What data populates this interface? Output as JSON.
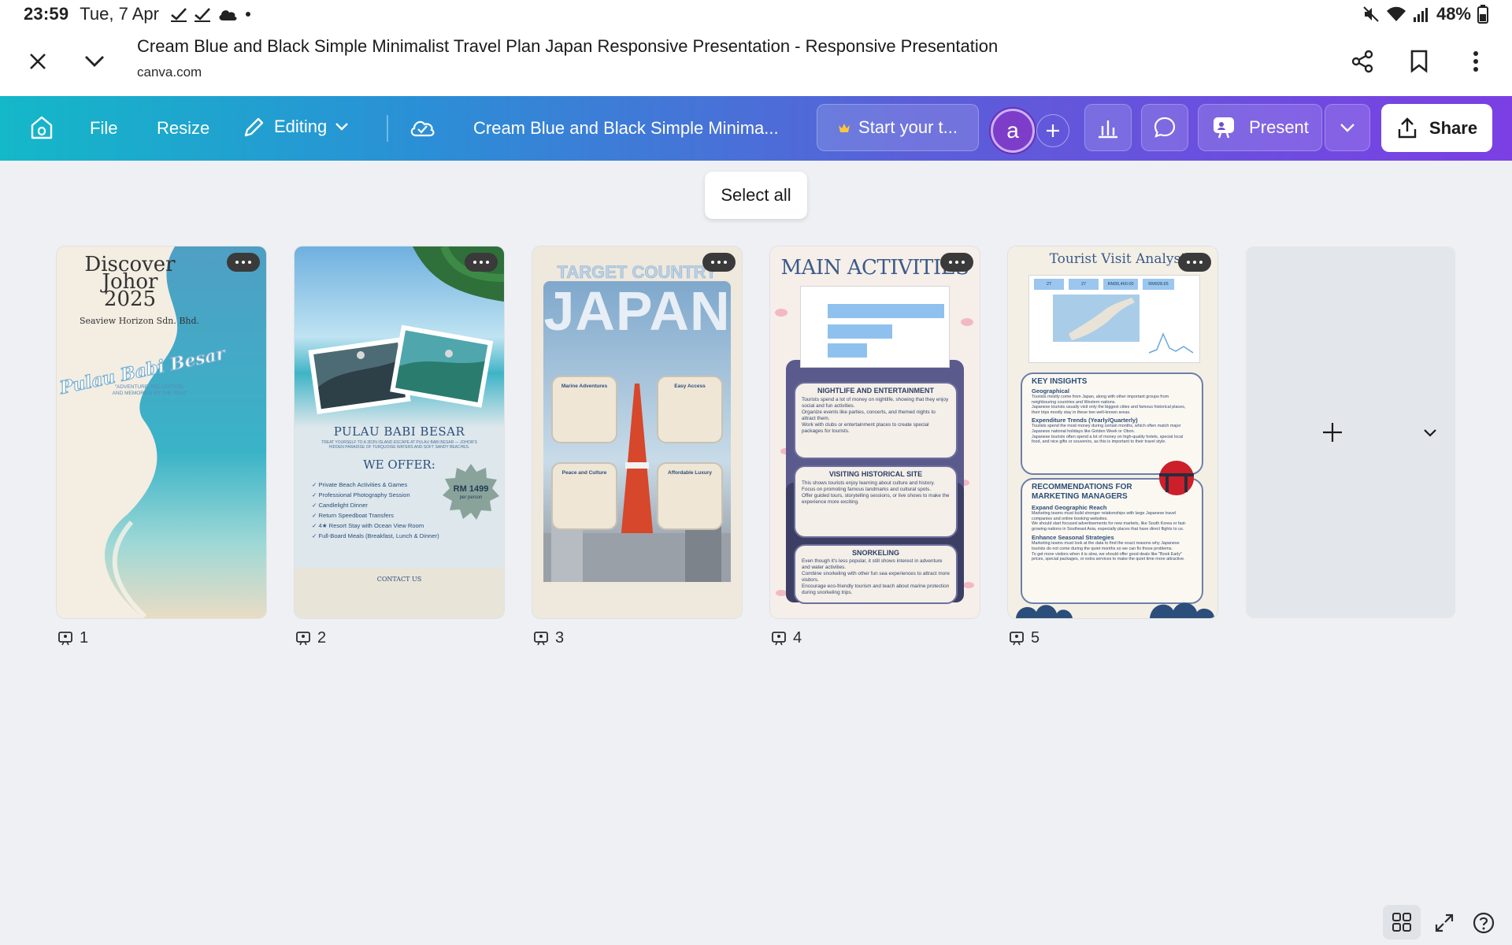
{
  "status_bar": {
    "time": "23:59",
    "date": "Tue, 7 Apr",
    "battery": "48%"
  },
  "browser": {
    "page_title": "Cream Blue and Black Simple Minimalist Travel Plan Japan Responsive Presentation - Responsive Presentation",
    "domain": "canva.com"
  },
  "toolbar": {
    "file": "File",
    "resize": "Resize",
    "editing": "Editing",
    "doc_title": "Cream Blue and Black Simple Minima...",
    "trial": "Start your t...",
    "avatar_letter": "a",
    "present": "Present",
    "share": "Share"
  },
  "canvas": {
    "select_all": "Select all"
  },
  "slides": [
    {
      "number": "1",
      "title_lines": [
        "Discover",
        "Johor",
        "2025"
      ],
      "company": "Seaview Horizon Sdn. Bhd.",
      "script_title": "Pulau Babi Besar",
      "tagline": "\"ADVENTURE, RELAXATION, AND MEMORIES BY THE SEA!\""
    },
    {
      "number": "2",
      "title": "PULAU BABI BESAR",
      "subtitle": "TREAT YOURSELF TO A 3D2N ISLAND ESCAPE AT PULAU BABI BESAR — JOHOR'S HIDDEN PARADISE OF TURQUOISE WATERS AND SOFT SANDY BEACHES.",
      "offer_heading": "WE OFFER:",
      "offers": [
        "Private Beach Activities & Games",
        "Professional Photography Session",
        "Candlelight Dinner",
        "Return Speedboat Transfers",
        "4★ Resort Stay with Ocean View Room",
        "Full-Board Meals (Breakfast, Lunch & Dinner)"
      ],
      "price": "RM 1499",
      "price_unit": "per person",
      "contacts_heading": "CONTACT US"
    },
    {
      "number": "3",
      "kicker": "TARGET COUNTRY",
      "title": "JAPAN",
      "cards": [
        "Marine Adventures",
        "Easy Access",
        "Peace and Culture",
        "Affordable Luxury"
      ]
    },
    {
      "number": "4",
      "title": "MAIN ACTIVITIES",
      "sections": [
        {
          "heading": "NIGHTLIFE AND ENTERTAINMENT",
          "bullets": [
            "Tourists spend a lot of money on nightlife, showing that they enjoy social and fun activities.",
            "Organize events like parties, concerts, and themed nights to attract them.",
            "Work with clubs or entertainment places to create special packages for tourists."
          ]
        },
        {
          "heading": "VISITING HISTORICAL SITE",
          "bullets": [
            "This shows tourists enjoy learning about culture and history.",
            "Focus on promoting famous landmarks and cultural spots.",
            "Offer guided tours, storytelling sessions, or live shows to make the experience more exciting."
          ]
        },
        {
          "heading": "SNORKELING",
          "bullets": [
            "Even though it's less popular, it still shows interest in adventure and water activities.",
            "Combine snorkeling with other fun sea experiences to attract more visitors.",
            "Encourage eco-friendly tourism and teach about marine protection during snorkeling trips."
          ]
        }
      ]
    },
    {
      "number": "5",
      "title": "Tourist Visit Analysis",
      "kpis": [
        "27",
        "27",
        "RM36,460.00",
        "RM928.65"
      ],
      "insights_heading": "KEY INSIGHTS",
      "insights": [
        {
          "subheading": "Geographical",
          "bullets": [
            "Tourists mostly come from Japan, along with other important groups from neighbouring countries and Western nations.",
            "Japanese tourists usually visit only the biggest cities and famous historical places, their trips mostly stay in these two well-known areas."
          ]
        },
        {
          "subheading": "Expenditure Trends (Yearly/Quarterly)",
          "bullets": [
            "Tourists spend the most money during certain months, which often match major Japanese national holidays like Golden Week or Obon.",
            "Japanese tourists often spend a lot of money on high-quality hotels, special local food, and nice gifts or souvenirs, as this is important to their travel style."
          ]
        }
      ],
      "recs_heading_lines": [
        "RECOMMENDATIONS FOR",
        "MARKETING MANAGERS"
      ],
      "recs": [
        {
          "subheading": "Expand Geographic Reach",
          "bullets": [
            "Marketing teams must build stronger relationships with large Japanese travel companies and online booking websites.",
            "We should start focused advertisements for new markets, like South Korea or fast-growing nations in Southeast Asia, especially places that have direct flights to us."
          ]
        },
        {
          "subheading": "Enhance Seasonal Strategies",
          "bullets": [
            "Marketing teams must look at the data to find the exact reasons why Japanese tourists do not come during the quiet months so we can fix those problems.",
            "To get more visitors when it is slow, we should offer good deals like \"Book Early\" prices, special packages, or extra services to make the quiet time more attractive."
          ]
        }
      ]
    }
  ],
  "colors": {
    "toolbar_start": "#14b8c8",
    "toolbar_end": "#7b3fe4",
    "canvas_bg": "#eef0f3",
    "avatar": "#7d3dc9"
  }
}
